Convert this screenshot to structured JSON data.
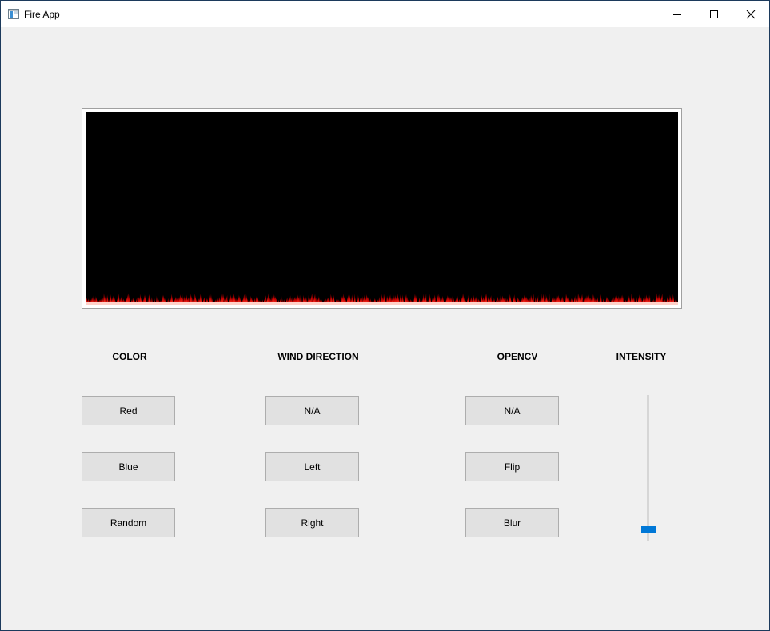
{
  "window": {
    "title": "Fire App",
    "controls": [
      "minimize",
      "maximize",
      "close"
    ]
  },
  "fire": {
    "flame_color": "red"
  },
  "sections": {
    "color": {
      "label": "COLOR",
      "buttons": [
        "Red",
        "Blue",
        "Random"
      ]
    },
    "wind": {
      "label": "WIND DIRECTION",
      "buttons": [
        "N/A",
        "Left",
        "Right"
      ]
    },
    "opencv": {
      "label": "OPENCV",
      "buttons": [
        "N/A",
        "Flip",
        "Blur"
      ]
    },
    "intensity": {
      "label": "INTENSITY",
      "level": 0.05
    }
  },
  "colors": {
    "accent": "#0078d7",
    "button_bg": "#e1e1e1",
    "window_bg": "#f0f0f0"
  }
}
